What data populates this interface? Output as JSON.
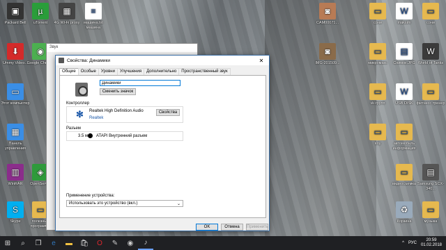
{
  "desktop_icons": [
    {
      "label": "Packard Bell",
      "icon": "packard-bell-icon",
      "color": "#333333",
      "glyph": "▣"
    },
    {
      "label": "uTorrent",
      "icon": "utorrent-icon",
      "color": "#2a9d3a",
      "glyph": "µ"
    },
    {
      "label": "4G Wi-Fi proxy",
      "icon": "network-icon",
      "color": "#444444",
      "glyph": "▦"
    },
    {
      "label": "машина.txt машина",
      "icon": "text-file-icon",
      "color": "#ffffff",
      "glyph": "≡"
    },
    {
      "label": "CAM00071...",
      "icon": "photo-icon",
      "color": "#b87b55",
      "glyph": "◙"
    },
    {
      "label": "сони",
      "icon": "folder-icon",
      "color": "#e6b94f",
      "glyph": "▭"
    },
    {
      "label": "maksim",
      "icon": "document-icon",
      "color": "#ffffff",
      "glyph": "W"
    },
    {
      "label": "сони",
      "icon": "folder-icon",
      "color": "#e6b94f",
      "glyph": "▭"
    },
    {
      "label": "Ummy Video...",
      "icon": "ummy-icon",
      "color": "#d42a2a",
      "glyph": "⬇"
    },
    {
      "label": "Google Chrome",
      "icon": "chrome-icon",
      "color": "#4caf50",
      "glyph": "◉"
    },
    {
      "label": "IMG-201509...",
      "icon": "photo-icon",
      "color": "#8a6b4a",
      "glyph": "◙"
    },
    {
      "label": "микромакс",
      "icon": "folder-icon",
      "color": "#e6b94f",
      "glyph": "▭"
    },
    {
      "label": "Снимок.JPG",
      "icon": "image-file-icon",
      "color": "#ffffff",
      "glyph": "▤"
    },
    {
      "label": "World of Tanks",
      "icon": "tanks-icon",
      "color": "#3b3b3b",
      "glyph": "W"
    },
    {
      "label": "Этот компьютер",
      "icon": "computer-icon",
      "color": "#3a8ee6",
      "glyph": "▭"
    },
    {
      "label": "vk-групп",
      "icon": "folder-icon",
      "color": "#e6b94f",
      "glyph": "▭"
    },
    {
      "label": "USB DISK",
      "icon": "word-icon",
      "color": "#ffffff",
      "glyph": "W"
    },
    {
      "label": "фитнесс тренер",
      "icon": "folder-icon",
      "color": "#e6b94f",
      "glyph": "▭"
    },
    {
      "label": "Панель управления",
      "icon": "control-panel-icon",
      "color": "#3a8ee6",
      "glyph": "▦"
    },
    {
      "label": "ялу",
      "icon": "folder-icon",
      "color": "#e6b94f",
      "glyph": "▭"
    },
    {
      "label": "автомобиль информация",
      "icon": "folder-icon",
      "color": "#e6b94f",
      "glyph": "▭"
    },
    {
      "label": "WinRAR",
      "icon": "winrar-icon",
      "color": "#8b2d8b",
      "glyph": "▥"
    },
    {
      "label": "OpenServer",
      "icon": "openserver-icon",
      "color": "#2f9a3b",
      "glyph": "◈"
    },
    {
      "label": "видеосъемка",
      "icon": "folder-icon",
      "color": "#e6b94f",
      "glyph": "▭"
    },
    {
      "label": "Samsung SCX-340...",
      "icon": "printer-icon",
      "color": "#555555",
      "glyph": "▤"
    },
    {
      "label": "Skype",
      "icon": "skype-icon",
      "color": "#00aff0",
      "glyph": "S"
    },
    {
      "label": "полезные программы",
      "icon": "folder-icon",
      "color": "#e6b94f",
      "glyph": "▭"
    },
    {
      "label": "Корзина",
      "icon": "recycle-bin-icon",
      "color": "#9ab",
      "glyph": "♻"
    },
    {
      "label": "музыка",
      "icon": "folder-icon",
      "color": "#e6b94f",
      "glyph": "▭"
    }
  ],
  "background_window": {
    "title": "Звук"
  },
  "dialog": {
    "title": "Свойства: Динамики",
    "close_glyph": "✕",
    "tabs": [
      "Общие",
      "Особые",
      "Уровни",
      "Улучшения",
      "Дополнительно",
      "Пространственный звук"
    ],
    "active_tab": "Общие",
    "device_name": "Динамики",
    "change_icon_label": "Сменить значок",
    "controller_label": "Контроллер",
    "controller_name": "Realtek High Definition Audio",
    "controller_vendor": "Realtek",
    "properties_label": "Свойства",
    "jack_label": "Разъем",
    "jack_size": "3.5 мм",
    "jack_desc": "ATAPI Внутренний разъем",
    "device_usage_label": "Применение устройства:",
    "device_usage_value": "Использовать это устройство (вкл.)",
    "ok_label": "OK",
    "cancel_label": "Отмена",
    "apply_label": "Применить"
  },
  "taskbar": {
    "start_glyph": "⊞",
    "search_glyph": "⌕",
    "task_view_glyph": "❐",
    "items": [
      {
        "name": "edge",
        "glyph": "e",
        "color": "#3277bc"
      },
      {
        "name": "explorer",
        "glyph": "▬",
        "color": "#f0c040"
      },
      {
        "name": "store",
        "glyph": "🛍",
        "color": "#dddddd"
      },
      {
        "name": "opera",
        "glyph": "O",
        "color": "#e0282e"
      },
      {
        "name": "notepad",
        "glyph": "✎",
        "color": "#cccccc"
      },
      {
        "name": "camera",
        "glyph": "◉",
        "color": "#cccccc"
      },
      {
        "name": "sound",
        "glyph": "♪",
        "color": "#cccccc"
      }
    ],
    "tray_chevron": "^",
    "language": "РУС",
    "time": "20:59",
    "date": "01.02.2018"
  }
}
